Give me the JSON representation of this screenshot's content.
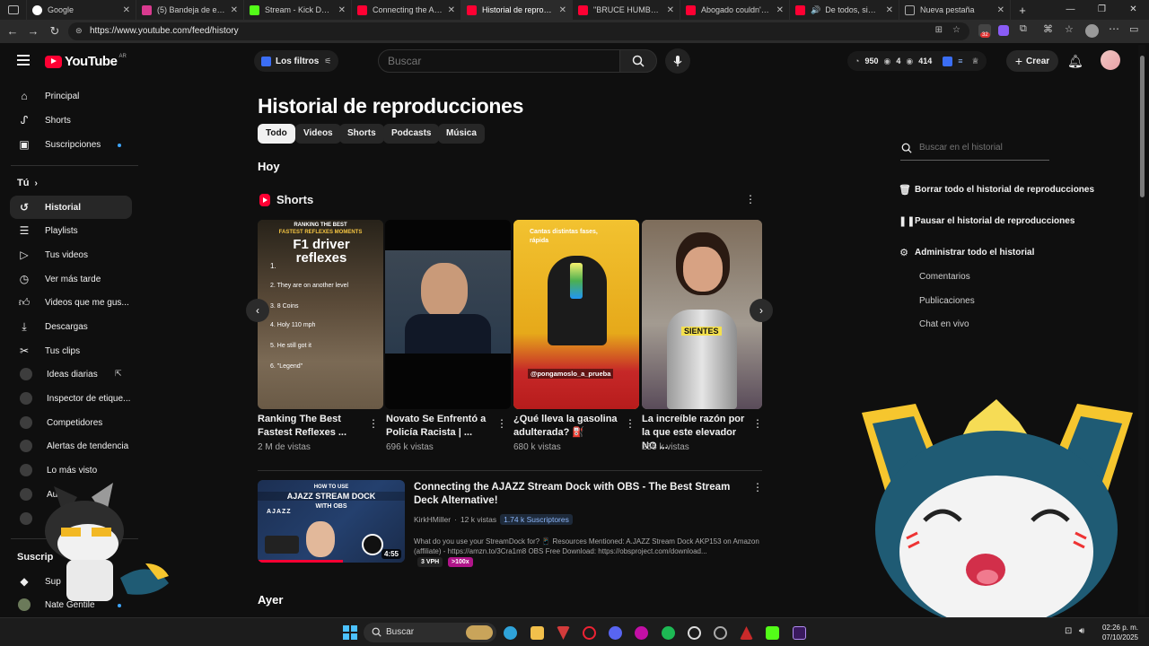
{
  "browser": {
    "tabs": [
      {
        "label": "Google",
        "color": "#4285f4",
        "active": false
      },
      {
        "label": "(5) Bandeja de entrada",
        "color": "#d93a8f",
        "active": false
      },
      {
        "label": "Stream - Kick Dashboard",
        "color": "#53fc18",
        "active": false
      },
      {
        "label": "Connecting the AJAZZ",
        "color": "#ff0033",
        "active": false
      },
      {
        "label": "Historial de reproducción",
        "color": "#ff0033",
        "active": true
      },
      {
        "label": "\"BRUCE HUMBLED THE",
        "color": "#ff0033",
        "active": false
      },
      {
        "label": "Abogado couldn't help",
        "color": "#ff0033",
        "active": false
      },
      {
        "label": "De todos, sin duda",
        "color": "#ff0033",
        "active": false
      },
      {
        "label": "Nueva pestaña",
        "color": "#888888",
        "active": false
      }
    ],
    "url": "https://www.youtube.com/feed/history",
    "extension_badge": "32"
  },
  "header": {
    "logo_text": "YouTube",
    "logo_region": "AR",
    "filters_label": "Los filtros",
    "search_placeholder": "Buscar",
    "stats": [
      "950",
      "4",
      "414"
    ],
    "create_label": "Crear"
  },
  "sidebar": {
    "main": [
      {
        "label": "Principal",
        "icon": "home-icon"
      },
      {
        "label": "Shorts",
        "icon": "shorts-icon"
      },
      {
        "label": "Suscripciones",
        "icon": "subscriptions-icon"
      }
    ],
    "you_heading": "Tú",
    "you": [
      {
        "label": "Historial",
        "icon": "history-icon",
        "active": true
      },
      {
        "label": "Playlists",
        "icon": "playlists-icon"
      },
      {
        "label": "Tus videos",
        "icon": "your-videos-icon"
      },
      {
        "label": "Ver más tarde",
        "icon": "watch-later-icon"
      },
      {
        "label": "Videos que me gus...",
        "icon": "liked-icon"
      },
      {
        "label": "Descargas",
        "icon": "download-icon"
      },
      {
        "label": "Tus clips",
        "icon": "clips-icon"
      }
    ],
    "extensions": [
      {
        "label": "Ideas diarias"
      },
      {
        "label": "Inspector de etique..."
      },
      {
        "label": "Competidores"
      },
      {
        "label": "Alertas de tendencia"
      },
      {
        "label": "Lo más visto"
      },
      {
        "label": "Au"
      }
    ],
    "subs_heading": "Suscrip",
    "subs": [
      {
        "label": "Sup"
      },
      {
        "label": "Nate Gentile"
      }
    ]
  },
  "main": {
    "title": "Historial de reproducciones",
    "chips": [
      "Todo",
      "Videos",
      "Shorts",
      "Podcasts",
      "Música"
    ],
    "today_label": "Hoy",
    "shorts_label": "Shorts",
    "shorts": [
      {
        "title": "Ranking The Best Fastest Reflexes ...",
        "views": "2 M de vistas",
        "overlay_head": "RANKING THE BEST",
        "overlay_sub": "FASTEST REFLEXES MOMENTS",
        "overlay_big": "F1 driver reflexes",
        "overlay_lines": [
          "1.",
          "2. They are on another level",
          "3. 8 Coins",
          "4. Holy 110 mph",
          "5. He still got it",
          "6. \"Legend\""
        ]
      },
      {
        "title": "Novato Se Enfrentó a Policía Racista | ...",
        "views": "696 k vistas"
      },
      {
        "title": "¿Qué lleva la gasolina adulterada? ⛽",
        "views": "680 k vistas",
        "overlay_top": "Cantas distintas fases,",
        "overlay_top2": "rápida",
        "overlay_handle": "@pongamoslo_a_prueba"
      },
      {
        "title": "La increíble razón por la que este elevador NO ...",
        "views": "255 k vistas",
        "overlay_word": "SIENTES"
      }
    ],
    "video": {
      "title": "Connecting the AJAZZ Stream Dock with OBS - The Best Stream Deck Alternative!",
      "channel": "KirkHMiller",
      "views": "12 k vistas",
      "subs": "1.74 k Suscriptores",
      "description": "What do you use your StreamDock for? 📱 Resources Mentioned: A.JAZZ Stream Dock AKP153 on Amazon (affiliate) - https://amzn.to/3Cra1m8 OBS Free Download: https://obsproject.com/download...",
      "duration": "4:55",
      "thumb_head": "HOW TO USE",
      "thumb_main": "AJAZZ STREAM DOCK",
      "thumb_sub": "WITH OBS",
      "thumb_brand": "AJAZZ",
      "badge_vph": "3 VPH",
      "badge_ratio": ">100x"
    },
    "yesterday_label": "Ayer"
  },
  "right_panel": {
    "search_placeholder": "Buscar en el historial",
    "clear_all": "Borrar todo el historial de reproducciones",
    "pause": "Pausar el historial de reproducciones",
    "manage": "Administrar todo el historial",
    "sub_items": [
      "Comentarios",
      "Publicaciones",
      "Chat en vivo"
    ]
  },
  "taskbar": {
    "search_label": "Buscar",
    "time": "02:26 p. m.",
    "date": "07/10/2025"
  }
}
